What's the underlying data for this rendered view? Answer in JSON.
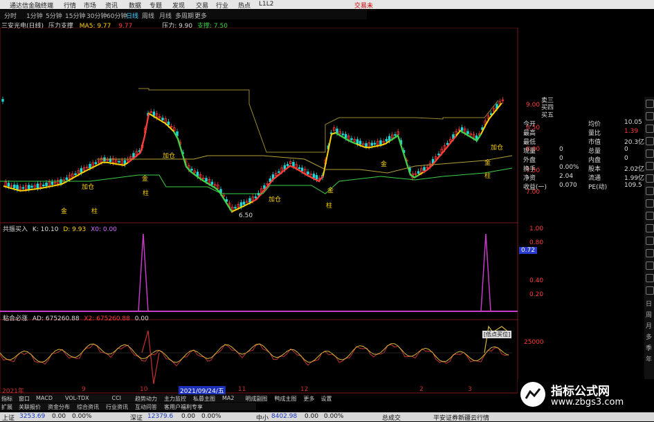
{
  "app": {
    "title": "通达信金融终端",
    "menu": [
      "行情",
      "市场",
      "资讯",
      "数据",
      "专题",
      "发现",
      "交易",
      "行业",
      "热点",
      "L1L2"
    ],
    "menu_right": "交易未",
    "periods": [
      "分时",
      "1分钟",
      "5分钟",
      "15分钟",
      "30分钟",
      "60分钟",
      "日线",
      "周线",
      "月线",
      "多周期",
      "更多"
    ],
    "selected_period": "日线"
  },
  "main_info": {
    "stock": "三安光电(日线)",
    "indicator": "压力支撑",
    "ma5_label": "MA5: 9.77",
    "ma5_value": "9.77",
    "pressure_label": "压力: 9.90",
    "support_label": "支撑: 7.50"
  },
  "panel1_info": {
    "name": "共振买入",
    "k": "K: 10.10",
    "d": "D: 9.93",
    "x": "X0: 0.00"
  },
  "panel2_info": {
    "name": "粘合必涨",
    "ad": "AD: 675260.88",
    "x2": "X2: 675260.88",
    "x3": "0.00"
  },
  "chart_annotations": [
    "加仓",
    "金",
    "柱",
    "加仓",
    "金",
    "柱",
    "加仓",
    "金",
    "柱",
    "金",
    "加仓",
    "金",
    "柱",
    "6.50"
  ],
  "right_axis_main": [
    "9.00",
    "8.50",
    "8.00",
    "7.50",
    "7.00"
  ],
  "right_axis_p1": [
    "1.00",
    "0.80",
    "0.72",
    "0.40",
    "0.20"
  ],
  "right_axis_p2": [
    "25000"
  ],
  "date_label": "2021/09/24/五",
  "x_ticks": [
    "2021年",
    "9",
    "10",
    "11",
    "12",
    "2",
    "3"
  ],
  "date_label_2": "2021年",
  "pressure_tag": "[低点买位]",
  "order_book": [
    "卖三",
    "买四",
    "买五"
  ],
  "quote_rows": [
    {
      "l": "今开",
      "v": "",
      "l2": "均价",
      "v2": "10.05"
    },
    {
      "l": "最高",
      "v": "",
      "l2": "量比",
      "v2": "1.39"
    },
    {
      "l": "最低",
      "v": "",
      "l2": "市值",
      "v2": "20.3亿"
    },
    {
      "l": "现量",
      "v": "0",
      "l2": "总量",
      "v2": "0"
    },
    {
      "l": "外盘",
      "v": "0",
      "l2": "内盘",
      "v2": "0"
    },
    {
      "l": "换手",
      "v": "0.00%",
      "l2": "股本",
      "v2": "2.02亿"
    },
    {
      "l": "净资",
      "v": "2.04",
      "l2": "流通",
      "v2": "1.99亿"
    },
    {
      "l": "收益(一)",
      "v": "0.070",
      "l2": "PE(动)",
      "v2": "109.5"
    }
  ],
  "right_strip_text": [
    "日",
    "周",
    "月",
    "多",
    "季",
    "年"
  ],
  "tabs_row1": [
    "指标",
    "窗口",
    "MACD",
    "VOL-TDX",
    "CCI",
    "趋势动力",
    "主力监控",
    "私募主图",
    "MA2",
    "明成副图",
    "鸭成主图",
    "更多",
    "设置"
  ],
  "tabs_row2": [
    "扩展",
    "关联报价",
    "资金分布",
    "综合资讯",
    "行业资讯",
    "互动问答",
    "客用户福利专享"
  ],
  "status": {
    "sh_label": "上证",
    "sh_value": "3253.69",
    "sh_change": "0.00",
    "sh_amount": "0.00%",
    "sz_label": "深证",
    "sz_value": "12379.6",
    "sz_change": "0.00",
    "sz_amount": "0.00%",
    "zx_label": "中小",
    "zx_value": "8402.98",
    "zx_change": "0.00",
    "zx_amount": "0.00%",
    "total_label": "总成交",
    "news": "平安证券新疆云行情"
  },
  "watermark": {
    "title": "指标公式网",
    "url": "www.zbgs3.com"
  },
  "colors": {
    "up": "#ff3b3b",
    "down": "#1fd6d6",
    "ma": "#ffd400",
    "support": "#3cd24a",
    "signal": "#c63bc6"
  }
}
